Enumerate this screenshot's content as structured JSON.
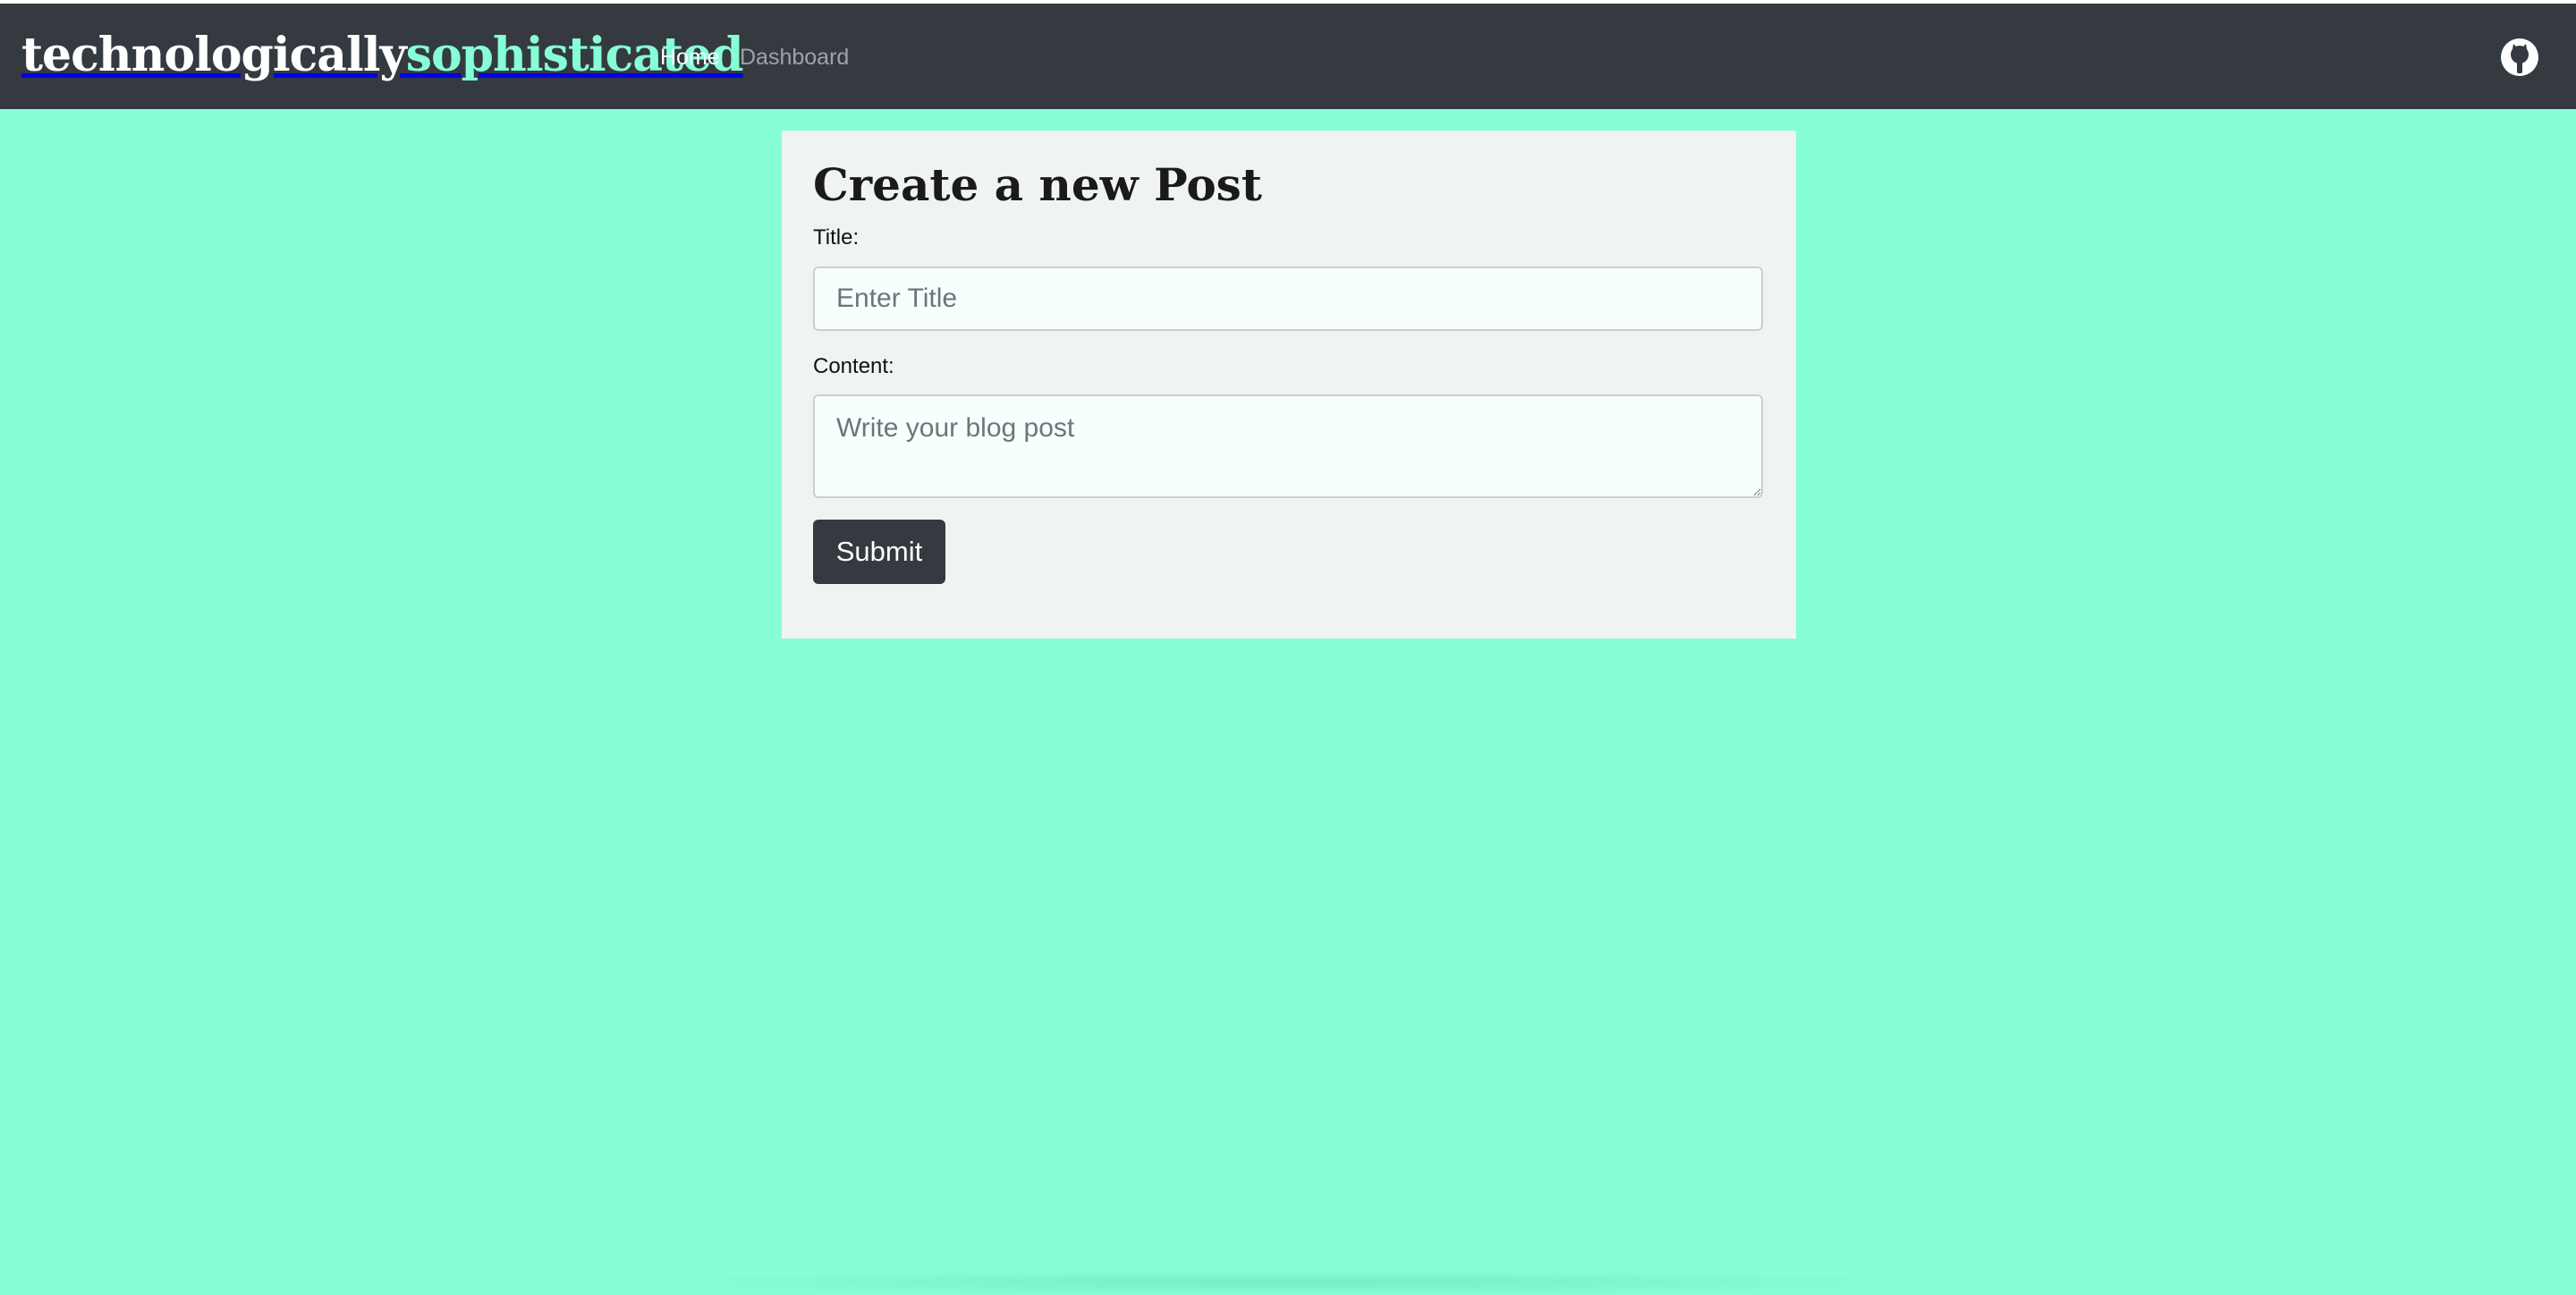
{
  "navbar": {
    "brand_part1": "technologically",
    "brand_part2": "sophisticated",
    "links": [
      {
        "label": "Home"
      },
      {
        "label": "Dashboard"
      }
    ],
    "profile_icon": "github-icon"
  },
  "form": {
    "heading": "Create a new Post",
    "title_label": "Title:",
    "title_placeholder": "Enter Title",
    "title_value": "",
    "content_label": "Content:",
    "content_placeholder": "Write your blog post",
    "content_value": "",
    "submit_label": "Submit"
  },
  "colors": {
    "background": "#86fed6",
    "navbar": "#353a41",
    "accent": "#86fed6",
    "card": "#eff4f2",
    "button": "#353a41"
  }
}
